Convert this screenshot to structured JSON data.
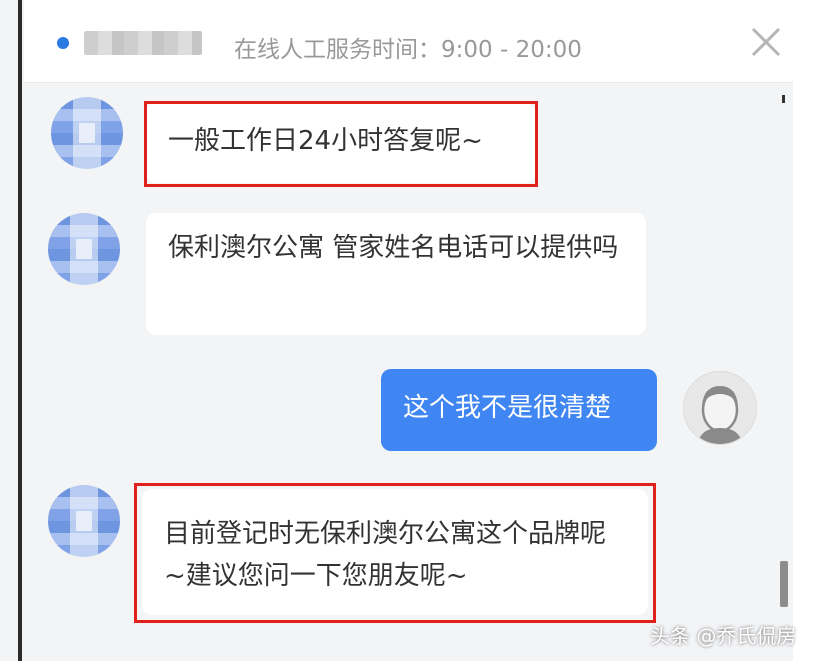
{
  "header": {
    "agent_name": "",
    "service_hours": "在线人工服务时间：9:00 - 20:00",
    "status_color": "#2a7ae2",
    "close_icon": "close-icon"
  },
  "messages": [
    {
      "sender": "agent",
      "text": "一般工作日24小时答复呢~",
      "highlighted": true
    },
    {
      "sender": "agent",
      "text": "保利澳尔公寓 管家姓名电话可以提供吗",
      "highlighted": false
    },
    {
      "sender": "user",
      "text": "这个我不是很清楚",
      "highlighted": false
    },
    {
      "sender": "agent",
      "text": "目前登记时无保利澳尔公寓这个品牌呢~建议您问一下您朋友呢~",
      "highlighted": true
    }
  ],
  "watermark": "头条 @乔氏侃房",
  "colors": {
    "user_bubble": "#3f86f2",
    "highlight_border": "#e0201b",
    "background": "#f3f4f6"
  }
}
